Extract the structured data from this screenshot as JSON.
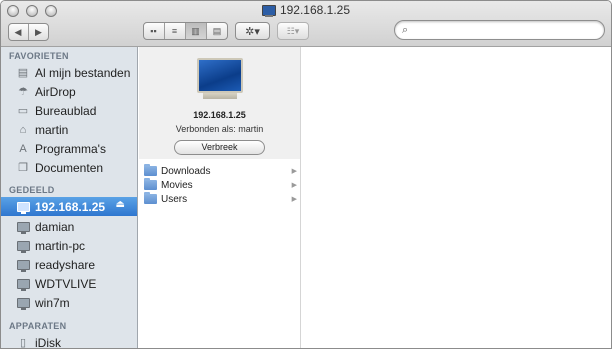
{
  "window": {
    "title": "192.168.1.25"
  },
  "toolbar": {
    "back_glyph": "◀",
    "forward_glyph": "▶",
    "view_glyphs": [
      "▪▪",
      "≡",
      "▥",
      "▤"
    ],
    "action_glyph": "✲▾",
    "arrange_glyph": "☷▾",
    "search": {
      "placeholder": "",
      "icon": "search-icon",
      "glyph": "⌕"
    }
  },
  "sidebar": {
    "favorites_header": "FAVORIETEN",
    "favorites": [
      {
        "label": "Al mijn bestanden",
        "icon": "all-files-icon",
        "glyph": "▤"
      },
      {
        "label": "AirDrop",
        "icon": "airdrop-icon",
        "glyph": "☂"
      },
      {
        "label": "Bureaublad",
        "icon": "desktop-icon",
        "glyph": "▭"
      },
      {
        "label": "martin",
        "icon": "home-icon",
        "glyph": "⌂"
      },
      {
        "label": "Programma's",
        "icon": "applications-icon",
        "glyph": "A"
      },
      {
        "label": "Documenten",
        "icon": "documents-icon",
        "glyph": "❐"
      }
    ],
    "shared_header": "GEDEELD",
    "shared": [
      {
        "label": "192.168.1.25",
        "icon": "monitor-icon",
        "selected": true,
        "eject": "⏏"
      },
      {
        "label": "damian",
        "icon": "monitor-icon"
      },
      {
        "label": "martin-pc",
        "icon": "monitor-icon"
      },
      {
        "label": "readyshare",
        "icon": "monitor-icon"
      },
      {
        "label": "WDTVLIVE",
        "icon": "monitor-icon"
      },
      {
        "label": "win7m",
        "icon": "monitor-icon"
      }
    ],
    "devices_header": "APPARATEN",
    "devices": [
      {
        "label": "iDisk",
        "icon": "idisk-icon",
        "glyph": "▯"
      }
    ]
  },
  "preview": {
    "title": "192.168.1.25",
    "connected_as": "Verbonden als: martin",
    "disconnect_label": "Verbreek"
  },
  "column": {
    "items": [
      {
        "label": "Downloads",
        "arrow": "▶"
      },
      {
        "label": "Movies",
        "arrow": "▶"
      },
      {
        "label": "Users",
        "arrow": "▶"
      }
    ]
  },
  "colors": {
    "selection": "#2e76cf",
    "sidebar_bg": "#dee4ea",
    "section_header": "#6c7886",
    "folder": "#5d8fd0"
  }
}
